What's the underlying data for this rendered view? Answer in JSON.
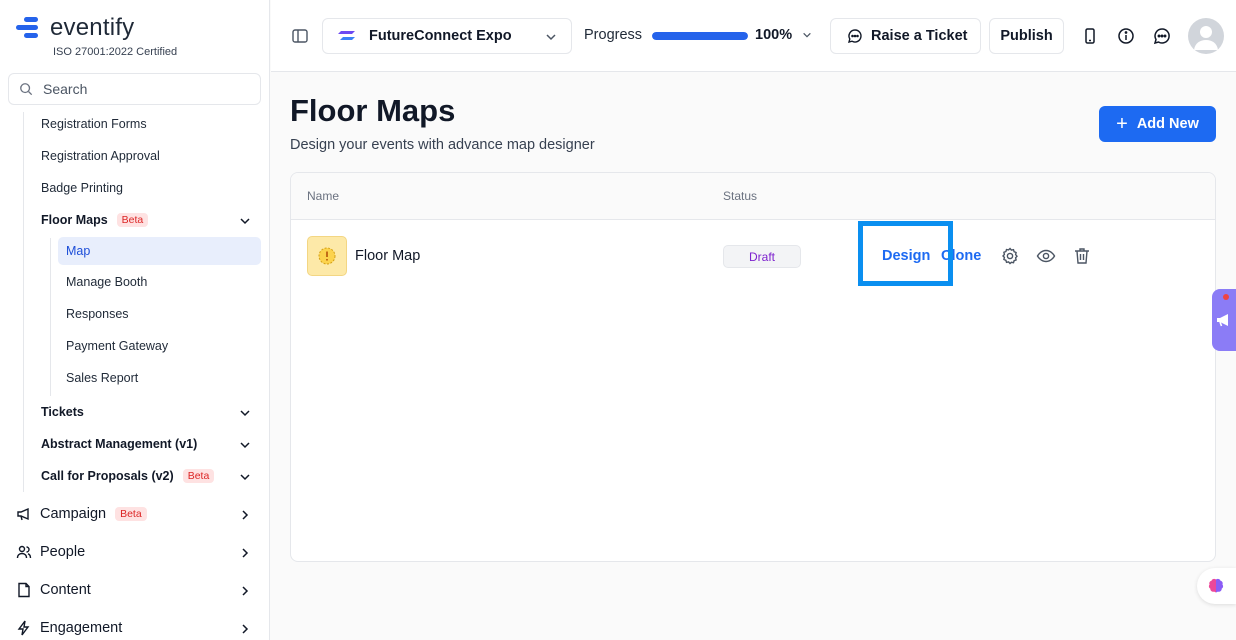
{
  "brand": {
    "name": "eventify",
    "cert": "ISO 27001:2022 Certified",
    "accent": "#2563eb"
  },
  "search": {
    "placeholder": "Search"
  },
  "sidebar": {
    "items": [
      {
        "label": "Registration Forms"
      },
      {
        "label": "Registration Approval"
      },
      {
        "label": "Badge Printing"
      },
      {
        "label": "Floor Maps",
        "badge": "Beta"
      },
      {
        "label": "Map"
      },
      {
        "label": "Manage Booth"
      },
      {
        "label": "Responses"
      },
      {
        "label": "Payment Gateway"
      },
      {
        "label": "Sales Report"
      },
      {
        "label": "Tickets"
      },
      {
        "label": "Abstract Management (v1)"
      },
      {
        "label": "Call for Proposals (v2)",
        "badge": "Beta"
      }
    ],
    "sections": [
      {
        "label": "Campaign",
        "badge": "Beta",
        "icon": "megaphone-icon"
      },
      {
        "label": "People",
        "icon": "people-icon"
      },
      {
        "label": "Content",
        "icon": "document-icon"
      },
      {
        "label": "Engagement",
        "icon": "bolt-icon"
      }
    ]
  },
  "header": {
    "event": "FutureConnect Expo",
    "progress_label": "Progress",
    "progress_pct": "100%",
    "progress_fraction": 1.0,
    "raise_ticket": "Raise a Ticket",
    "publish": "Publish"
  },
  "main": {
    "title": "Floor Maps",
    "subtitle": "Design your events with advance map designer",
    "add_new": "Add New",
    "table": {
      "headers": [
        "Name",
        "Status"
      ],
      "rows": [
        {
          "name": "Floor Map",
          "status": "Draft",
          "actions": [
            "Design",
            "Clone"
          ]
        }
      ]
    }
  }
}
